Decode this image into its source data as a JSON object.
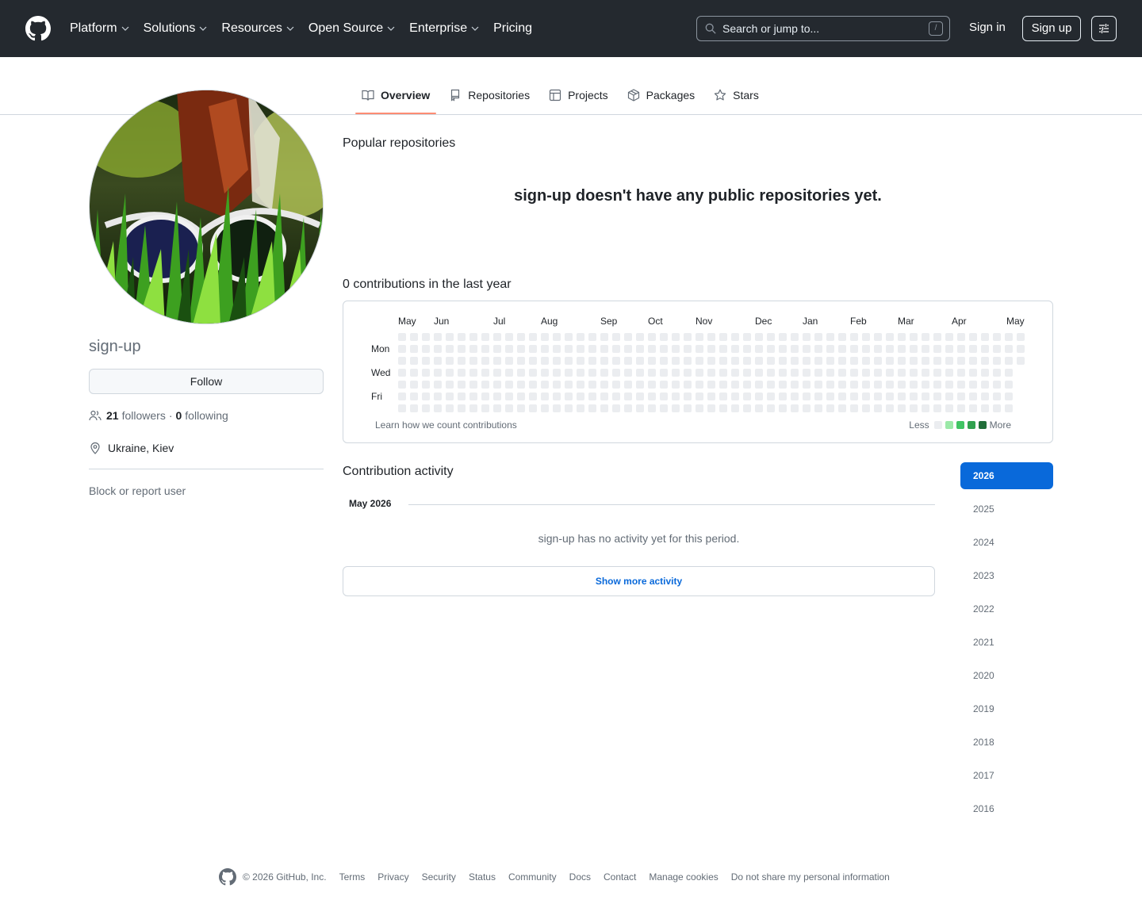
{
  "header": {
    "nav": [
      "Platform",
      "Solutions",
      "Resources",
      "Open Source",
      "Enterprise",
      "Pricing"
    ],
    "search_placeholder": "Search or jump to...",
    "search_shortcut": "/",
    "signin": "Sign in",
    "signup": "Sign up"
  },
  "tabs": [
    "Overview",
    "Repositories",
    "Projects",
    "Packages",
    "Stars"
  ],
  "profile": {
    "username": "sign-up",
    "follow_label": "Follow",
    "followers_count": "21",
    "followers_label": "followers",
    "separator": "·",
    "following_count": "0",
    "following_label": "following",
    "location": "Ukraine, Kiev",
    "block_label": "Block or report user"
  },
  "main": {
    "popular_title": "Popular repositories",
    "no_repos": "sign-up doesn't have any public repositories yet.",
    "contrib_title": "0 contributions in the last year",
    "months": [
      "May",
      "Jun",
      "Jul",
      "Aug",
      "Sep",
      "Oct",
      "Nov",
      "Dec",
      "Jan",
      "Feb",
      "Mar",
      "Apr",
      "May"
    ],
    "days": [
      "Mon",
      "Wed",
      "Fri"
    ],
    "learn": "Learn how we count contributions",
    "legend_less": "Less",
    "legend_more": "More",
    "legend_colors": [
      "#ebedf0",
      "#9be9a8",
      "#40c463",
      "#30a14e",
      "#216e39"
    ],
    "empty_cell_color": "#ebedf0",
    "activity_title": "Contribution activity",
    "month_label": "May 2026",
    "no_activity": "sign-up has no activity yet for this period.",
    "show_more": "Show more activity"
  },
  "years": [
    "2026",
    "2025",
    "2024",
    "2023",
    "2022",
    "2021",
    "2020",
    "2019",
    "2018",
    "2017",
    "2016"
  ],
  "footer": {
    "copyright": "© 2026 GitHub, Inc.",
    "links": [
      "Terms",
      "Privacy",
      "Security",
      "Status",
      "Community",
      "Docs",
      "Contact",
      "Manage cookies",
      "Do not share my personal information"
    ]
  }
}
